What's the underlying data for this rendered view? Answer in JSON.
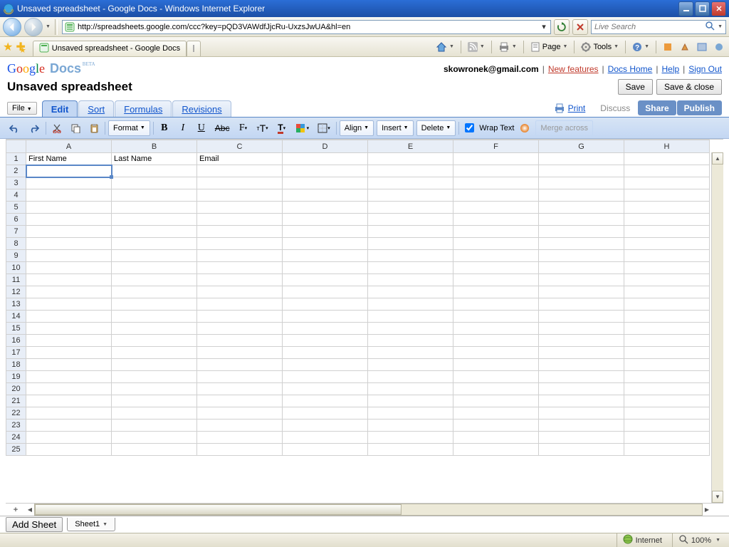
{
  "window": {
    "title": "Unsaved spreadsheet - Google Docs - Windows Internet Explorer"
  },
  "ie": {
    "url": "http://spreadsheets.google.com/ccc?key=pQD3VAWdfJjcRu-UxzsJwUA&hl=en",
    "search_placeholder": "Live Search",
    "tab_title": "Unsaved spreadsheet - Google Docs",
    "menu": {
      "page": "Page",
      "tools": "Tools"
    },
    "status": {
      "zone": "Internet",
      "zoom": "100%"
    }
  },
  "gd": {
    "user": "skowronek@gmail.com",
    "links": {
      "new_features": "New features",
      "docs_home": "Docs Home",
      "help": "Help",
      "sign_out": "Sign Out"
    },
    "doc_title": "Unsaved spreadsheet",
    "buttons": {
      "save": "Save",
      "save_close": "Save & close",
      "file": "File",
      "add_sheet": "Add Sheet"
    },
    "tabs": {
      "edit": "Edit",
      "sort": "Sort",
      "formulas": "Formulas",
      "revisions": "Revisions"
    },
    "right": {
      "print": "Print",
      "discuss": "Discuss",
      "share": "Share",
      "publish": "Publish"
    },
    "toolbar": {
      "format": "Format",
      "align": "Align",
      "insert": "Insert",
      "delete": "Delete",
      "wrap": "Wrap Text",
      "merge": "Merge across"
    },
    "sheet_name": "Sheet1",
    "columns": [
      "A",
      "B",
      "C",
      "D",
      "E",
      "F",
      "G",
      "H"
    ],
    "row1": {
      "A": "First Name",
      "B": "Last Name",
      "C": "Email"
    },
    "selected": "A2"
  }
}
